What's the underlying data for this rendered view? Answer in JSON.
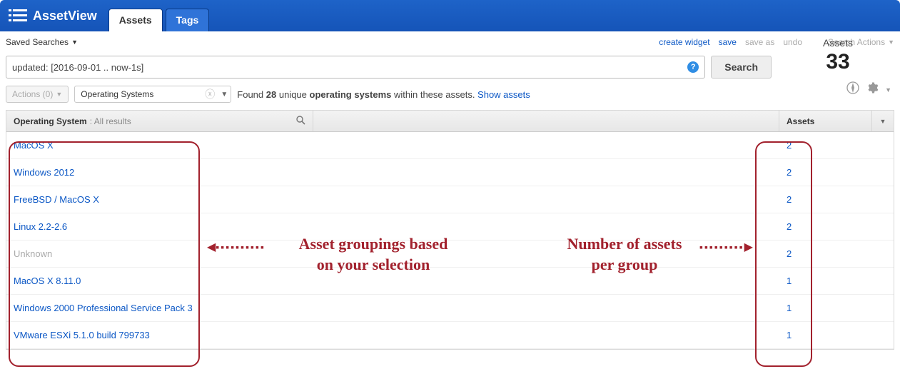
{
  "header": {
    "app_name": "AssetView",
    "tabs": [
      {
        "label": "Assets",
        "active": true
      },
      {
        "label": "Tags",
        "active": false
      }
    ]
  },
  "subbar": {
    "saved_searches": "Saved Searches",
    "links": {
      "create_widget": "create widget",
      "save": "save",
      "save_as": "save as",
      "undo": "undo",
      "search_actions": "Search Actions"
    }
  },
  "search": {
    "query": "updated: [2016-09-01 .. now-1s]",
    "button": "Search"
  },
  "assets_panel": {
    "label": "Assets",
    "count": "33"
  },
  "filter": {
    "actions_label": "Actions (0)",
    "group_by": "Operating Systems",
    "found_prefix": "Found ",
    "found_count": "28",
    "found_mid1": " unique ",
    "found_bold": "operating systems",
    "found_mid2": " within these assets. ",
    "show_assets": "Show assets"
  },
  "table": {
    "header_os": "Operating System",
    "header_os_sub": ": All results",
    "header_assets": "Assets",
    "rows": [
      {
        "os": "MacOS X",
        "count": "2",
        "unknown": false
      },
      {
        "os": "Windows 2012",
        "count": "2",
        "unknown": false
      },
      {
        "os": "FreeBSD / MacOS X",
        "count": "2",
        "unknown": false
      },
      {
        "os": "Linux 2.2-2.6",
        "count": "2",
        "unknown": false
      },
      {
        "os": "Unknown",
        "count": "2",
        "unknown": true
      },
      {
        "os": "MacOS X 8.11.0",
        "count": "1",
        "unknown": false
      },
      {
        "os": "Windows 2000 Professional Service Pack 3",
        "count": "1",
        "unknown": false
      },
      {
        "os": "VMware ESXi 5.1.0 build 799733",
        "count": "1",
        "unknown": false
      }
    ]
  },
  "annotations": {
    "left": "Asset groupings based\non your selection",
    "right": "Number of assets\nper group"
  }
}
